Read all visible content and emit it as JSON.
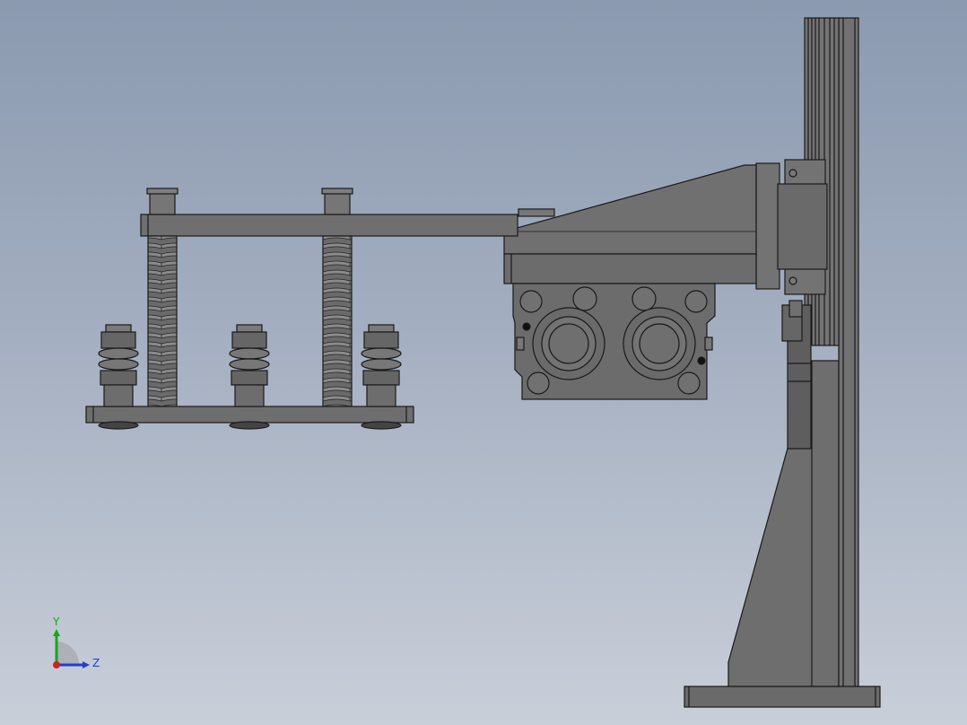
{
  "viewport": {
    "background_top": "#8b9ab0",
    "background_bottom": "#c9cfd9",
    "part_fill": "#6e6e6e",
    "part_fill_light": "#7c7c7c",
    "part_edge": "#1a1a1a"
  },
  "triad": {
    "y_label": "Y",
    "z_label": "Z",
    "y_color": "#19a619",
    "z_color": "#1f3fd1",
    "x_color": "#d11f1f"
  }
}
